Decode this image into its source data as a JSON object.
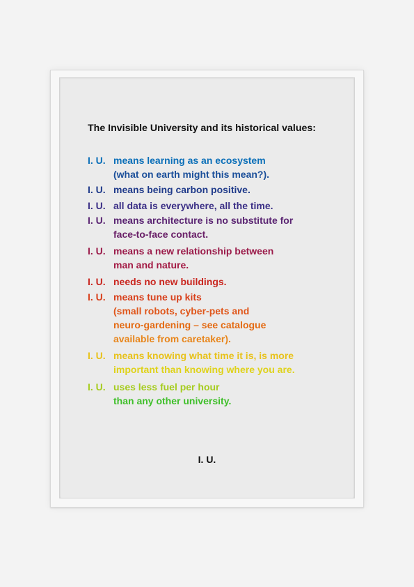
{
  "poster": {
    "title": "The Invisible University and its historical values:",
    "prefix": "I. U.",
    "items": [
      {
        "lines": [
          "means learning as an ecosystem",
          "(what on earth might this mean?)."
        ],
        "color": "#0b6fb8",
        "color2": "#1b4f9a"
      },
      {
        "lines": [
          "means being carbon positive."
        ],
        "color": "#1f3a8a",
        "color2": "#1f3a8a"
      },
      {
        "lines": [
          "all data is everywhere, all the time."
        ],
        "color": "#3b2f86",
        "color2": "#3b2f86"
      },
      {
        "lines": [
          "means architecture is no substitute for",
          "face-to-face contact."
        ],
        "color": "#5a2472",
        "color2": "#6a2068"
      },
      {
        "lines": [
          "means a new relationship between",
          "man and nature."
        ],
        "color": "#9b1b4a",
        "color2": "#a31a44"
      },
      {
        "lines": [
          "needs no new buildings."
        ],
        "color": "#c9261f",
        "color2": "#c9261f"
      },
      {
        "lines": [
          "means tune up kits",
          "(small robots, cyber-pets and",
          "neuro-gardening – see catalogue",
          "available from caretaker)."
        ],
        "color": "#d83f1a",
        "color2": "#e46a12",
        "color3": "#e8851a"
      },
      {
        "lines": [
          "means knowing what time it is, is more",
          "important than knowing where you are."
        ],
        "color": "#e8c21a",
        "color2": "#dfd21a"
      },
      {
        "lines": [
          "uses less fuel per hour",
          "than any other university."
        ],
        "color": "#a6cc1f",
        "color2": "#3fbf2a"
      }
    ],
    "signature": "I. U."
  }
}
